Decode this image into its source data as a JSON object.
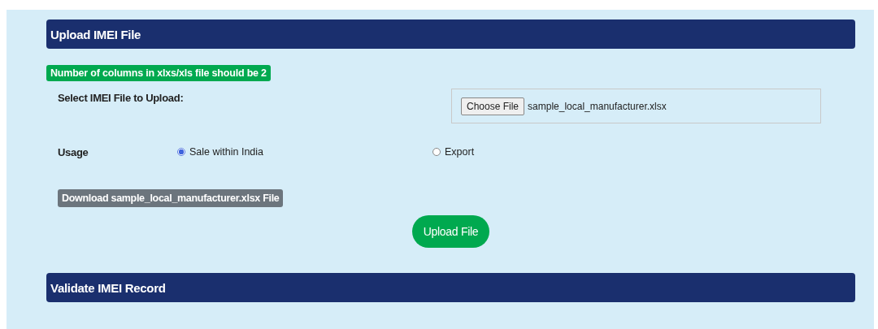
{
  "upload_section": {
    "title": "Upload IMEI File"
  },
  "notice": "Number of columns in xlxs/xls file should be 2",
  "file_field": {
    "label": "Select IMEI File to Upload:",
    "button": "Choose File",
    "value": "sample_local_manufacturer.xlsx"
  },
  "usage": {
    "label": "Usage",
    "options": [
      {
        "label": "Sale within India",
        "selected": true
      },
      {
        "label": "Export",
        "selected": false
      }
    ]
  },
  "download_link": "Download sample_local_manufacturer.xlsx File",
  "upload_button": "Upload File",
  "validate_section": {
    "title": "Validate IMEI Record"
  }
}
